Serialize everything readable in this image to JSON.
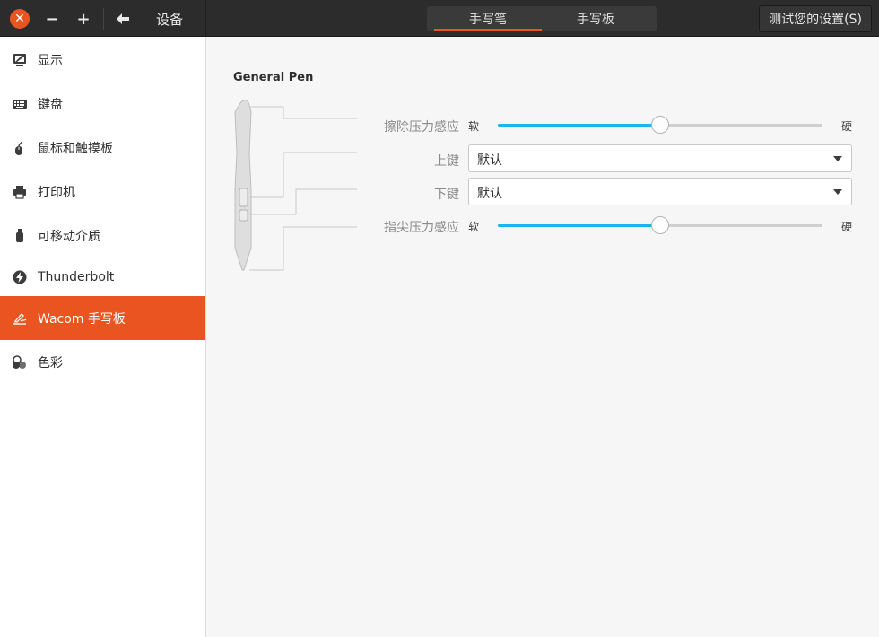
{
  "header": {
    "title": "设备",
    "tabs": [
      {
        "label": "手写笔",
        "active": true
      },
      {
        "label": "手写板",
        "active": false
      }
    ],
    "test_button": "测试您的设置(S)"
  },
  "sidebar": {
    "items": [
      {
        "label": "显示",
        "icon": "display-icon"
      },
      {
        "label": "键盘",
        "icon": "keyboard-icon"
      },
      {
        "label": "鼠标和触摸板",
        "icon": "mouse-icon"
      },
      {
        "label": "打印机",
        "icon": "printer-icon"
      },
      {
        "label": "可移动介质",
        "icon": "usb-drive-icon"
      },
      {
        "label": "Thunderbolt",
        "icon": "thunderbolt-icon"
      },
      {
        "label": "Wacom 手写板",
        "icon": "wacom-tablet-icon",
        "active": true
      },
      {
        "label": "色彩",
        "icon": "color-icon"
      }
    ]
  },
  "main": {
    "pen_name": "General Pen",
    "eraser_pressure": {
      "label": "擦除压力感应",
      "min_label": "软",
      "max_label": "硬",
      "value": 0.5
    },
    "upper_button": {
      "label": "上键",
      "value": "默认"
    },
    "lower_button": {
      "label": "下键",
      "value": "默认"
    },
    "tip_pressure": {
      "label": "指尖压力感应",
      "min_label": "软",
      "max_label": "硬",
      "value": 0.5
    }
  },
  "colors": {
    "accent": "#e95420",
    "slider": "#19b6ee",
    "headerbar": "#2c2c2c"
  }
}
